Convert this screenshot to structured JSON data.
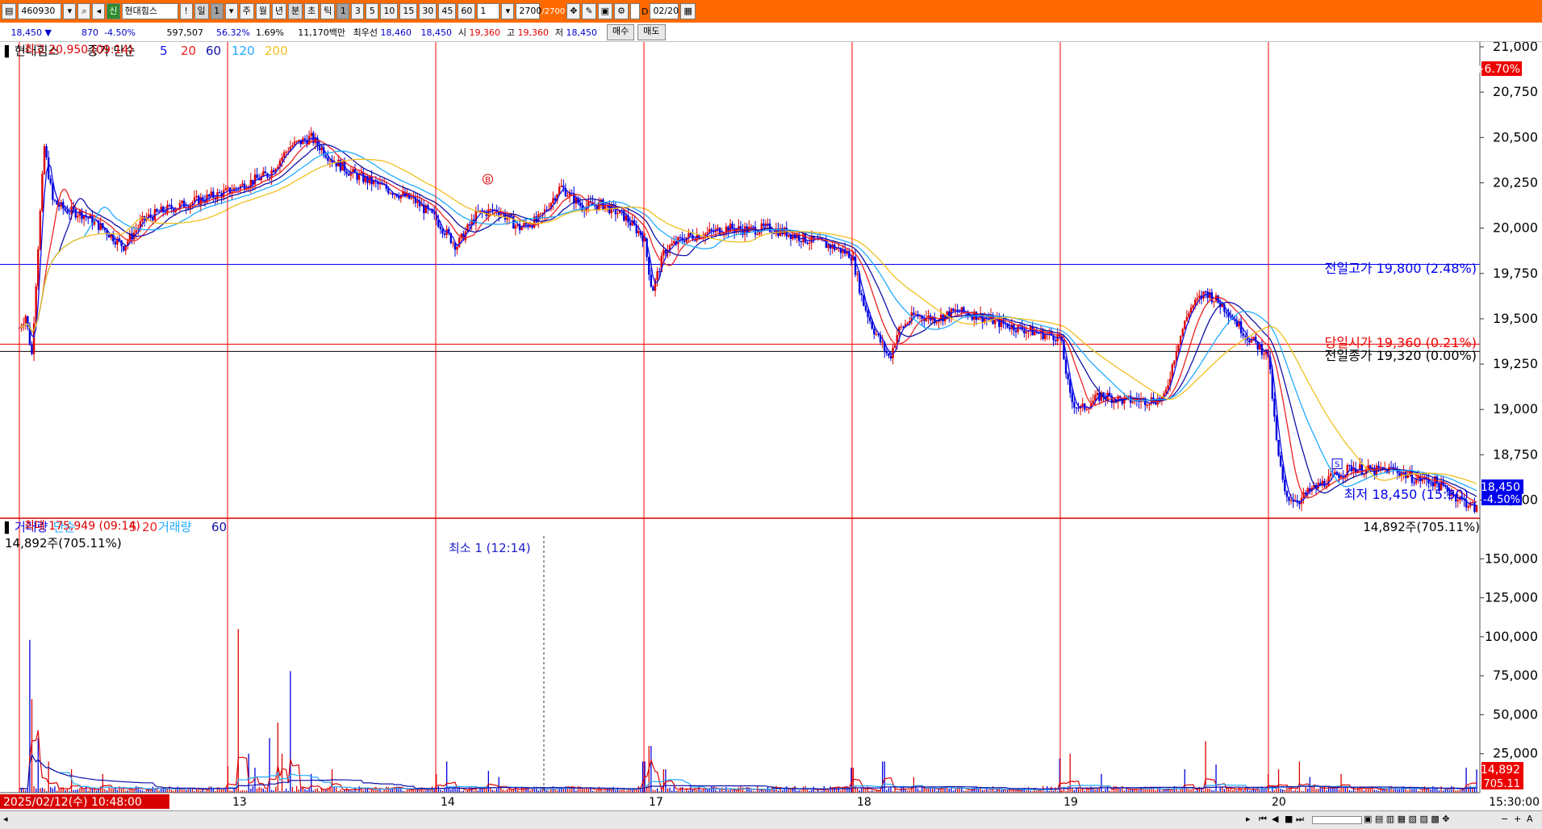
{
  "toolbar": {
    "code": "460930",
    "stock_name": "현대힘스",
    "stock_badge": "신",
    "periods": [
      "일",
      "주",
      "월",
      "년"
    ],
    "minute_label": "분",
    "second_label": "초",
    "tick_label": "틱",
    "intervals": [
      "1",
      "3",
      "5",
      "10",
      "15",
      "30",
      "45",
      "60"
    ],
    "interval_value": "1",
    "count_value": "2700",
    "count_total": "/2700",
    "date_value": "02/20",
    "d_label": "D"
  },
  "info": {
    "price": "18,450",
    "arrow": "▼",
    "change": "870",
    "change_pct": "-4.50%",
    "volume": "597,507",
    "vol_ratio": "56.32%",
    "turnover": "1.69%",
    "amount": "11,170백만",
    "best_ask_label": "최우선",
    "best_ask": "18,460",
    "best_bid": "18,450",
    "open_label": "시",
    "open": "19,360",
    "high_label": "고",
    "high": "19,360",
    "low_label": "저",
    "low": "18,450",
    "buy_label": "매수",
    "sell_label": "매도"
  },
  "colors": {
    "up": "#dd0000",
    "down": "#0000dd",
    "ma5": "#1010ee",
    "ma20": "#ee2020",
    "ma60": "#1010aa",
    "ma120": "#22aaff",
    "ma200": "#f0c020",
    "vline": "#ff0000",
    "grid": "#888888"
  },
  "chart_data": {
    "type": "candlestick",
    "price_legend": {
      "name": "현대힘스",
      "series_label": "종가 단순",
      "periods": [
        "5",
        "20",
        "60",
        "120",
        "200"
      ]
    },
    "price_ylim": [
      18400,
      21000
    ],
    "price_ticks": [
      "21,000",
      "20,750",
      "20,500",
      "20,250",
      "20,000",
      "19,750",
      "19,500",
      "19,250",
      "19,000",
      "18,750",
      "18,500"
    ],
    "price_axis_top_pct": "+6.70%",
    "price_axis_bottom_pct": "-4.50%",
    "current_price_label": "18,450",
    "high_marker": "최고 20,950 (09:14)",
    "low_marker": "최저 18,450 (15:30)",
    "ref_lines": [
      {
        "label": "전일고가 19,800 (2.48%)",
        "value": 19800,
        "color": "#0000ee"
      },
      {
        "label": "당일시가 19,360 (0.21%)",
        "value": 19360,
        "color": "#ee0000"
      },
      {
        "label": "전일종가 19,320 (0.00%)",
        "value": 19320,
        "color": "#000000"
      }
    ],
    "day_labels": [
      "2025/02/12(수) 10:48:00",
      "13",
      "14",
      "17",
      "18",
      "19",
      "20"
    ],
    "end_time": "15:30:00",
    "signals": [
      {
        "letter": "B",
        "day_pos": 2.25,
        "price": 20270
      },
      {
        "letter": "S",
        "day_pos": 6.33,
        "price": 18700
      }
    ],
    "price_anchors": [
      [
        0.0,
        19450
      ],
      [
        0.03,
        19520
      ],
      [
        0.06,
        19300
      ],
      [
        0.09,
        19900
      ],
      [
        0.12,
        20450
      ],
      [
        0.16,
        20150
      ],
      [
        0.22,
        20100
      ],
      [
        0.3,
        20080
      ],
      [
        0.4,
        20000
      ],
      [
        0.5,
        19900
      ],
      [
        0.6,
        20050
      ],
      [
        0.7,
        20100
      ],
      [
        0.85,
        20150
      ],
      [
        1.0,
        20200
      ],
      [
        1.1,
        20250
      ],
      [
        1.2,
        20300
      ],
      [
        1.3,
        20450
      ],
      [
        1.4,
        20500
      ],
      [
        1.5,
        20380
      ],
      [
        1.6,
        20300
      ],
      [
        1.7,
        20250
      ],
      [
        1.8,
        20200
      ],
      [
        1.9,
        20150
      ],
      [
        2.0,
        20050
      ],
      [
        2.1,
        19900
      ],
      [
        2.2,
        20080
      ],
      [
        2.3,
        20100
      ],
      [
        2.4,
        20000
      ],
      [
        2.5,
        20050
      ],
      [
        2.6,
        20230
      ],
      [
        2.7,
        20120
      ],
      [
        2.8,
        20130
      ],
      [
        2.9,
        20070
      ],
      [
        3.0,
        19950
      ],
      [
        3.04,
        19650
      ],
      [
        3.1,
        19880
      ],
      [
        3.2,
        19950
      ],
      [
        3.3,
        19970
      ],
      [
        3.4,
        20000
      ],
      [
        3.5,
        19990
      ],
      [
        3.6,
        20000
      ],
      [
        3.7,
        19970
      ],
      [
        3.8,
        19930
      ],
      [
        3.9,
        19900
      ],
      [
        4.0,
        19850
      ],
      [
        4.05,
        19600
      ],
      [
        4.1,
        19450
      ],
      [
        4.18,
        19280
      ],
      [
        4.22,
        19430
      ],
      [
        4.3,
        19520
      ],
      [
        4.4,
        19500
      ],
      [
        4.5,
        19540
      ],
      [
        4.6,
        19520
      ],
      [
        4.7,
        19480
      ],
      [
        4.8,
        19450
      ],
      [
        4.9,
        19420
      ],
      [
        5.0,
        19400
      ],
      [
        5.05,
        19050
      ],
      [
        5.1,
        19000
      ],
      [
        5.2,
        19080
      ],
      [
        5.3,
        19050
      ],
      [
        5.4,
        19050
      ],
      [
        5.5,
        19060
      ],
      [
        5.56,
        19350
      ],
      [
        5.62,
        19550
      ],
      [
        5.7,
        19650
      ],
      [
        5.8,
        19550
      ],
      [
        5.9,
        19400
      ],
      [
        6.0,
        19300
      ],
      [
        6.04,
        18800
      ],
      [
        6.08,
        18520
      ],
      [
        6.15,
        18500
      ],
      [
        6.2,
        18550
      ],
      [
        6.3,
        18620
      ],
      [
        6.4,
        18680
      ],
      [
        6.5,
        18660
      ],
      [
        6.6,
        18670
      ],
      [
        6.7,
        18620
      ],
      [
        6.8,
        18600
      ],
      [
        6.9,
        18520
      ],
      [
        7.0,
        18450
      ]
    ],
    "volume_legend": {
      "name": "거래량",
      "series_label": "단순",
      "periods": [
        "5",
        "20"
      ],
      "extra_name": "거래량",
      "extra_period": "60"
    },
    "volume_ylim": [
      0,
      175000
    ],
    "volume_ticks": [
      "150,000",
      "125,000",
      "100,000",
      "75,000",
      "50,000",
      "25,000"
    ],
    "volume_current_label": "14,892",
    "volume_current_pct": "705.11",
    "volume_readout": "14,892주(705.11%)",
    "volume_max_marker": "최대 175,949 (09:14)",
    "volume_min_marker": "최소 1 (12:14)",
    "volume_spikes": [
      [
        0.05,
        98000
      ],
      [
        0.06,
        60000
      ],
      [
        0.09,
        35000
      ],
      [
        0.14,
        20000
      ],
      [
        0.25,
        15000
      ],
      [
        0.4,
        12000
      ],
      [
        1.0,
        17000
      ],
      [
        1.05,
        105000
      ],
      [
        1.1,
        25000
      ],
      [
        1.13,
        16000
      ],
      [
        1.2,
        35000
      ],
      [
        1.24,
        45000
      ],
      [
        1.26,
        25000
      ],
      [
        1.3,
        78000
      ],
      [
        1.4,
        12000
      ],
      [
        1.5,
        15000
      ],
      [
        2.0,
        12000
      ],
      [
        2.05,
        20000
      ],
      [
        2.25,
        14000
      ],
      [
        2.3,
        10000
      ],
      [
        3.0,
        20000
      ],
      [
        3.03,
        30000
      ],
      [
        3.1,
        15000
      ],
      [
        4.0,
        16000
      ],
      [
        4.15,
        20000
      ],
      [
        4.3,
        10000
      ],
      [
        5.0,
        22000
      ],
      [
        5.05,
        25000
      ],
      [
        5.2,
        12000
      ],
      [
        5.6,
        15000
      ],
      [
        5.7,
        33000
      ],
      [
        5.75,
        18000
      ],
      [
        6.0,
        12000
      ],
      [
        6.05,
        15000
      ],
      [
        6.15,
        20000
      ],
      [
        6.2,
        10000
      ],
      [
        6.35,
        12000
      ],
      [
        6.95,
        16000
      ],
      [
        7.0,
        14892
      ]
    ]
  }
}
